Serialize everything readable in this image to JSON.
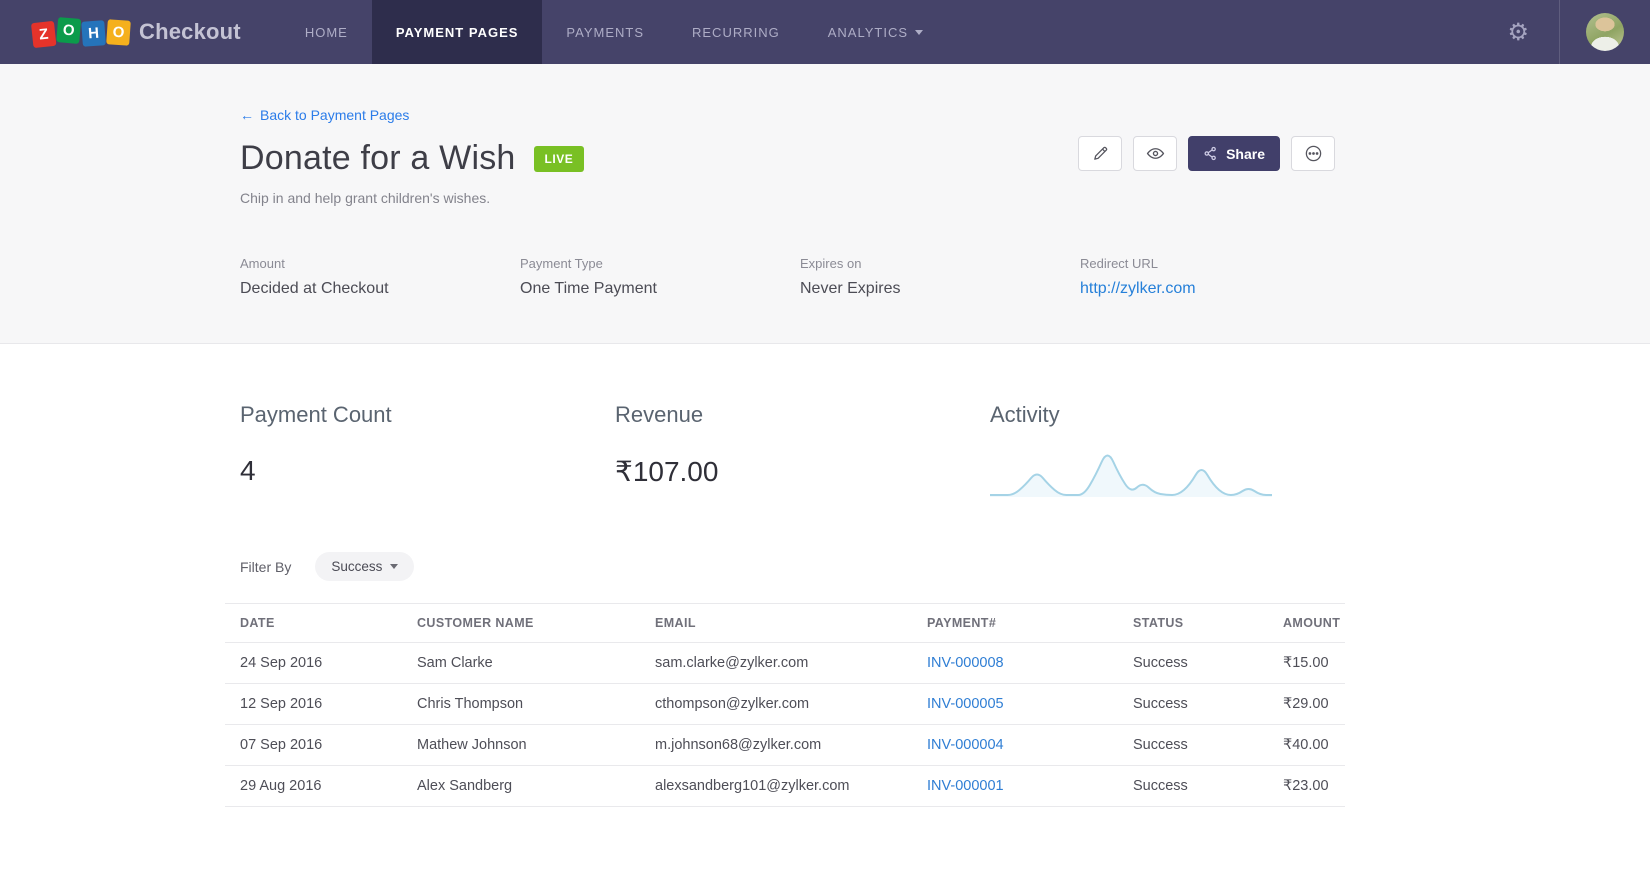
{
  "nav": {
    "brand": {
      "logo_letters": [
        "Z",
        "O",
        "H",
        "O"
      ],
      "logo_colors": [
        "#e5332a",
        "#0b9b4b",
        "#2574bb",
        "#f5b01d"
      ],
      "product": "Checkout"
    },
    "items": [
      {
        "label": "HOME"
      },
      {
        "label": "PAYMENT PAGES"
      },
      {
        "label": "PAYMENTS"
      },
      {
        "label": "RECURRING"
      },
      {
        "label": "ANALYTICS"
      }
    ]
  },
  "header": {
    "back_arrow": "←",
    "back_link": "Back to Payment Pages",
    "title": "Donate for a Wish",
    "status_badge": "LIVE",
    "subtitle": "Chip in and help grant children's wishes.",
    "share_label": "Share"
  },
  "details": [
    {
      "label": "Amount",
      "value": "Decided at Checkout"
    },
    {
      "label": "Payment Type",
      "value": "One Time Payment"
    },
    {
      "label": "Expires on",
      "value": "Never Expires"
    },
    {
      "label": "Redirect URL",
      "value": "http://zylker.com"
    }
  ],
  "stats": {
    "payment_count_label": "Payment Count",
    "payment_count_value": "4",
    "revenue_label": "Revenue",
    "revenue_value": "₹107.00",
    "activity_label": "Activity"
  },
  "chart_data": {
    "type": "area",
    "title": "Activity",
    "values": [
      2,
      2,
      2,
      12,
      26,
      12,
      2,
      2,
      2,
      22,
      48,
      22,
      4,
      15,
      4,
      2,
      2,
      12,
      32,
      12,
      2,
      2,
      10,
      2,
      2
    ],
    "max": 50,
    "line_color": "#a5d3e6",
    "fill_color": "#f0f8fc",
    "axes": "none"
  },
  "filter": {
    "label": "Filter By",
    "selected": "Success"
  },
  "table": {
    "columns": [
      "DATE",
      "CUSTOMER NAME",
      "EMAIL",
      "PAYMENT#",
      "STATUS",
      "AMOUNT"
    ],
    "rows": [
      {
        "date": "24 Sep 2016",
        "customer": "Sam Clarke",
        "email": "sam.clarke@zylker.com",
        "payment": "INV-000008",
        "status": "Success",
        "amount": "₹15.00"
      },
      {
        "date": "12 Sep 2016",
        "customer": "Chris Thompson",
        "email": "cthompson@zylker.com",
        "payment": "INV-000005",
        "status": "Success",
        "amount": "₹29.00"
      },
      {
        "date": "07 Sep 2016",
        "customer": "Mathew Johnson",
        "email": "m.johnson68@zylker.com",
        "payment": "INV-000004",
        "status": "Success",
        "amount": "₹40.00"
      },
      {
        "date": "29 Aug 2016",
        "customer": "Alex Sandberg",
        "email": "alexsandberg101@zylker.com",
        "payment": "INV-000001",
        "status": "Success",
        "amount": "₹23.00"
      }
    ]
  },
  "colors": {
    "nav_bg": "#454369",
    "nav_active_bg": "#2e2d4c",
    "live_badge": "#79c024",
    "link_blue": "#2b7ce9",
    "share_btn": "#413f6a"
  }
}
